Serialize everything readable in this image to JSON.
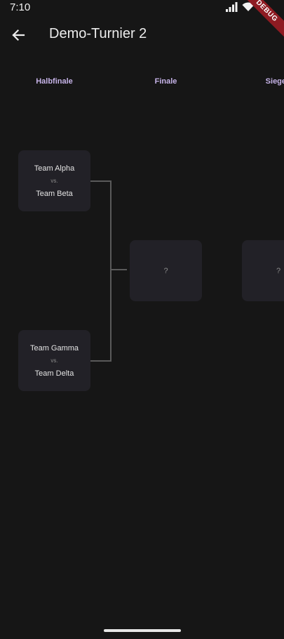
{
  "status_bar": {
    "time": "7:10",
    "debug_label": "DEBUG"
  },
  "app_bar": {
    "title": "Demo-Turnier 2"
  },
  "rounds": [
    {
      "label": "Halbfinale"
    },
    {
      "label": "Finale"
    },
    {
      "label": "Sieger"
    }
  ],
  "matches": {
    "semi_1": {
      "team_a": "Team Alpha",
      "vs": "vs.",
      "team_b": "Team Beta"
    },
    "semi_2": {
      "team_a": "Team Gamma",
      "vs": "vs.",
      "team_b": "Team Delta"
    },
    "final": {
      "placeholder": "?"
    },
    "winner": {
      "placeholder": "?"
    }
  },
  "colors": {
    "background": "#161616",
    "card": "#222127",
    "round_header": "#c6b3e8",
    "connector": "#5a5a5a",
    "debug_banner": "#8e1b22"
  }
}
